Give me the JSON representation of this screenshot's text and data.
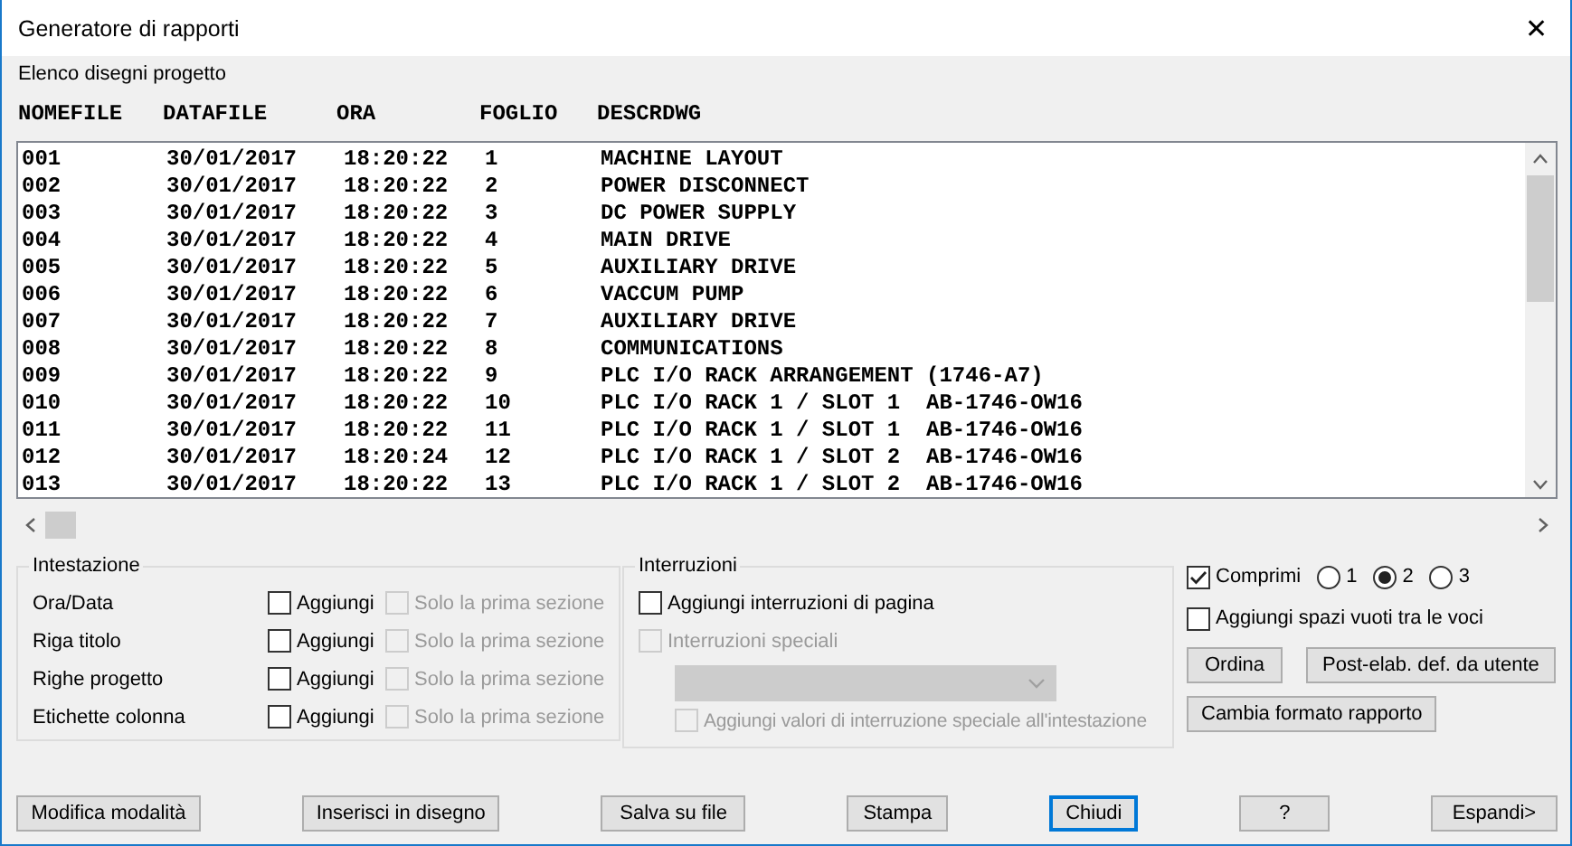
{
  "window": {
    "title": "Generatore di rapporti",
    "close": "✕"
  },
  "list_label": "Elenco disegni progetto",
  "columns": [
    "NOMEFILE",
    "DATAFILE",
    "ORA",
    "FOGLIO",
    "DESCRDWG"
  ],
  "rows": [
    [
      "001",
      "30/01/2017",
      "18:20:22",
      "1",
      "MACHINE LAYOUT"
    ],
    [
      "002",
      "30/01/2017",
      "18:20:22",
      "2",
      "POWER DISCONNECT"
    ],
    [
      "003",
      "30/01/2017",
      "18:20:22",
      "3",
      "DC POWER SUPPLY"
    ],
    [
      "004",
      "30/01/2017",
      "18:20:22",
      "4",
      "MAIN DRIVE"
    ],
    [
      "005",
      "30/01/2017",
      "18:20:22",
      "5",
      "AUXILIARY DRIVE"
    ],
    [
      "006",
      "30/01/2017",
      "18:20:22",
      "6",
      "VACCUM PUMP"
    ],
    [
      "007",
      "30/01/2017",
      "18:20:22",
      "7",
      "AUXILIARY DRIVE"
    ],
    [
      "008",
      "30/01/2017",
      "18:20:22",
      "8",
      "COMMUNICATIONS"
    ],
    [
      "009",
      "30/01/2017",
      "18:20:22",
      "9",
      "PLC I/O RACK ARRANGEMENT (1746-A7)"
    ],
    [
      "010",
      "30/01/2017",
      "18:20:22",
      "10",
      "PLC I/O RACK 1 / SLOT 1  AB-1746-OW16"
    ],
    [
      "011",
      "30/01/2017",
      "18:20:22",
      "11",
      "PLC I/O RACK 1 / SLOT 1  AB-1746-OW16"
    ],
    [
      "012",
      "30/01/2017",
      "18:20:24",
      "12",
      "PLC I/O RACK 1 / SLOT 2  AB-1746-OW16"
    ],
    [
      "013",
      "30/01/2017",
      "18:20:22",
      "13",
      "PLC I/O RACK 1 / SLOT 2  AB-1746-OW16"
    ]
  ],
  "intestazione": {
    "title": "Intestazione",
    "rows": [
      {
        "label": "Ora/Data",
        "add": {
          "label": "Aggiungi",
          "checked": false,
          "disabled": false
        },
        "first_section": {
          "label": "Solo la prima sezione",
          "checked": false,
          "disabled": true
        }
      },
      {
        "label": "Riga titolo",
        "add": {
          "label": "Aggiungi",
          "checked": false,
          "disabled": false
        },
        "first_section": {
          "label": "Solo la prima sezione",
          "checked": false,
          "disabled": true
        }
      },
      {
        "label": "Righe progetto",
        "add": {
          "label": "Aggiungi",
          "checked": false,
          "disabled": false
        },
        "first_section": {
          "label": "Solo la prima sezione",
          "checked": false,
          "disabled": true
        }
      },
      {
        "label": "Etichette colonna",
        "add": {
          "label": "Aggiungi",
          "checked": false,
          "disabled": false
        },
        "first_section": {
          "label": "Solo la prima sezione",
          "checked": false,
          "disabled": true
        }
      }
    ]
  },
  "interruzioni": {
    "title": "Interruzioni",
    "page_breaks": {
      "label": "Aggiungi interruzioni di pagina",
      "checked": false,
      "disabled": false
    },
    "special": {
      "label": "Interruzioni speciali",
      "checked": false,
      "disabled": true
    },
    "dropdown": {
      "disabled": true
    },
    "special_values": {
      "label": "Aggiungi valori di interruzione speciale all'intestazione",
      "checked": false,
      "disabled": true
    }
  },
  "comprimi": {
    "label": "Comprimi",
    "checked": true,
    "disabled": false
  },
  "levels": [
    {
      "label": "1",
      "selected": false
    },
    {
      "label": "2",
      "selected": true
    },
    {
      "label": "3",
      "selected": false
    }
  ],
  "blank_lines": {
    "label": "Aggiungi spazi vuoti tra le voci",
    "checked": false,
    "disabled": false
  },
  "option_buttons": [
    "Ordina",
    "Post-elab. def. da utente",
    "Cambia formato rapporto"
  ],
  "footer_buttons": [
    {
      "label": "Modifica modalità",
      "focused": false
    },
    {
      "label": "Inserisci in disegno",
      "focused": false
    },
    {
      "label": "Salva su file",
      "focused": false
    },
    {
      "label": "Stampa",
      "focused": false
    },
    {
      "label": "Chiudi",
      "focused": true
    },
    {
      "label": "?",
      "focused": false
    },
    {
      "label": "Espandi>",
      "focused": false
    }
  ]
}
